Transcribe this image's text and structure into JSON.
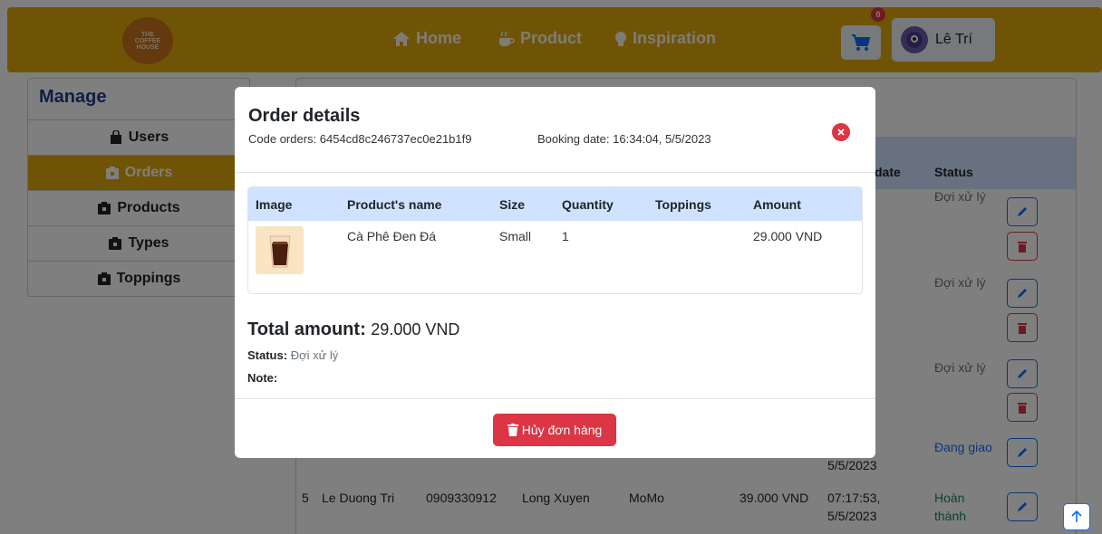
{
  "header": {
    "logo_text": [
      "THE",
      "COFFEE",
      "HOUSE"
    ],
    "nav": {
      "home": "Home",
      "product": "Product",
      "inspiration": "Inspiration"
    },
    "cart_count": "0",
    "user_name": "Lê Trí"
  },
  "sidebar": {
    "title": "Manage",
    "items": [
      {
        "label": "Users",
        "icon": "bag-icon"
      },
      {
        "label": "Orders",
        "icon": "clipboard-icon",
        "active": true
      },
      {
        "label": "Products",
        "icon": "clipboard-icon"
      },
      {
        "label": "Types",
        "icon": "clipboard-icon"
      },
      {
        "label": "Toppings",
        "icon": "clipboard-icon"
      }
    ]
  },
  "orders_table": {
    "headers": {
      "date": "date",
      "status": "Status"
    },
    "rows": [
      {
        "status": "Đợi xử lý"
      },
      {
        "status": "Đợi xử lý"
      },
      {
        "status": "Đợi xử lý"
      },
      {
        "status": "Đang giao",
        "date_line2": "5/5/2023"
      },
      {
        "index": "5",
        "name": "Le Duong Tri",
        "phone": "0909330912",
        "address": "Long Xuyen",
        "payment": "MoMo",
        "amount": "39.000 VND",
        "date_line1": "07:17:53,",
        "date_line2": "5/5/2023",
        "status_line1": "Hoàn",
        "status_line2": "thành"
      }
    ]
  },
  "modal": {
    "title": "Order details",
    "code_orders": "Code orders: 6454cd8c246737ec0e21b1f9",
    "booking_date": "Booking date: 16:34:04, 5/5/2023",
    "columns": {
      "image": "Image",
      "name": "Product's name",
      "size": "Size",
      "quantity": "Quantity",
      "toppings": "Toppings",
      "amount": "Amount"
    },
    "items": [
      {
        "name": "Cà Phê Đen Đá",
        "size": "Small",
        "quantity": "1",
        "toppings": "",
        "amount": "29.000 VND"
      }
    ],
    "total_label": "Total amount:",
    "total_value": "29.000 VND",
    "status_label": "Status:",
    "status_value": "Đợi xử lý",
    "note_label": "Note:",
    "cancel_label": "Hủy đơn hàng"
  },
  "colors": {
    "brand": "#e1a80a",
    "danger": "#dc3545",
    "primary": "#0d6efd",
    "table_head": "#cfe2ff"
  }
}
